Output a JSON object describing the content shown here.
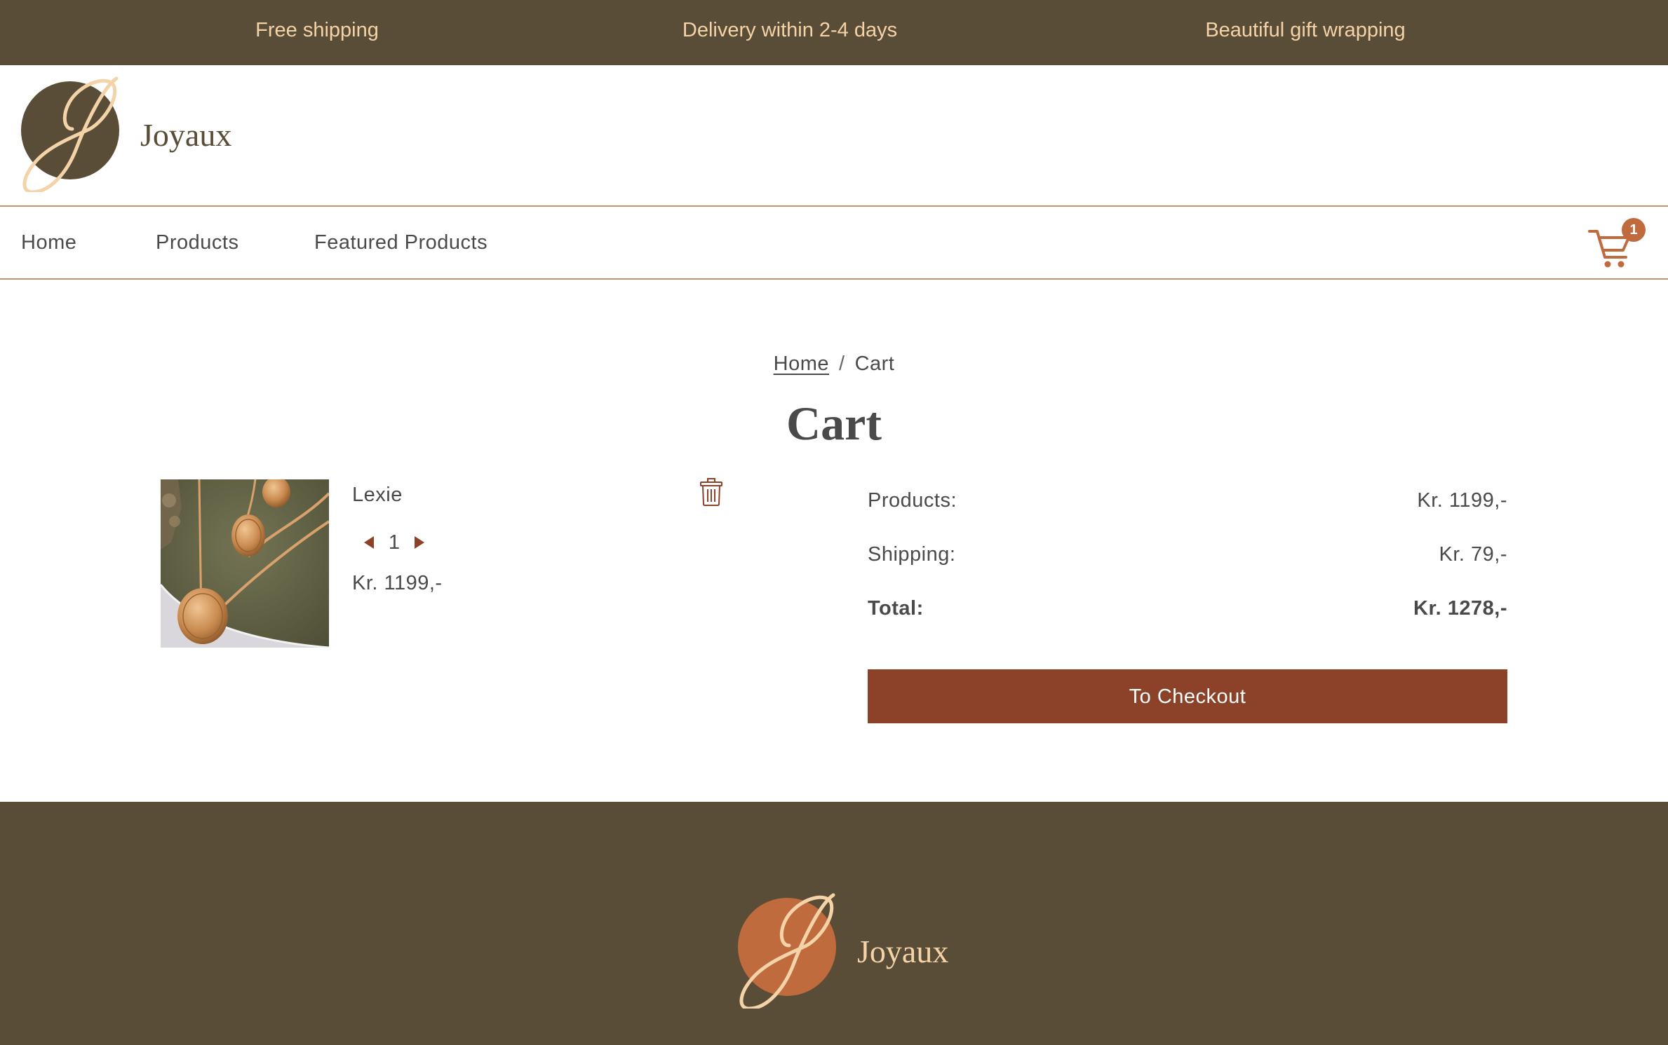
{
  "banner": {
    "messages": [
      "Free shipping",
      "Delivery within 2-4 days",
      "Beautiful gift wrapping"
    ]
  },
  "brand": {
    "name": "Joyaux",
    "monogram": "J",
    "primary_color": "#5a4d37",
    "accent_color": "#c06b3e",
    "cream_color": "#f3d3a7",
    "button_color": "#8b4229"
  },
  "nav": {
    "items": [
      "Home",
      "Products",
      "Featured Products"
    ],
    "cart_icon": "shopping-cart-icon",
    "cart_count": "1"
  },
  "breadcrumb": {
    "home": "Home",
    "separator": "/",
    "current": "Cart"
  },
  "page": {
    "title": "Cart"
  },
  "cart": {
    "items": [
      {
        "name": "Lexie",
        "quantity": "1",
        "price": "Kr. 1199,-",
        "image": "gold-coin-necklaces-photo",
        "remove_icon": "trash-icon"
      }
    ]
  },
  "summary": {
    "products_label": "Products:",
    "products_value": "Kr. 1199,-",
    "shipping_label": "Shipping:",
    "shipping_value": "Kr. 79,-",
    "total_label": "Total:",
    "total_value": "Kr. 1278,-",
    "checkout_label": "To Checkout"
  }
}
